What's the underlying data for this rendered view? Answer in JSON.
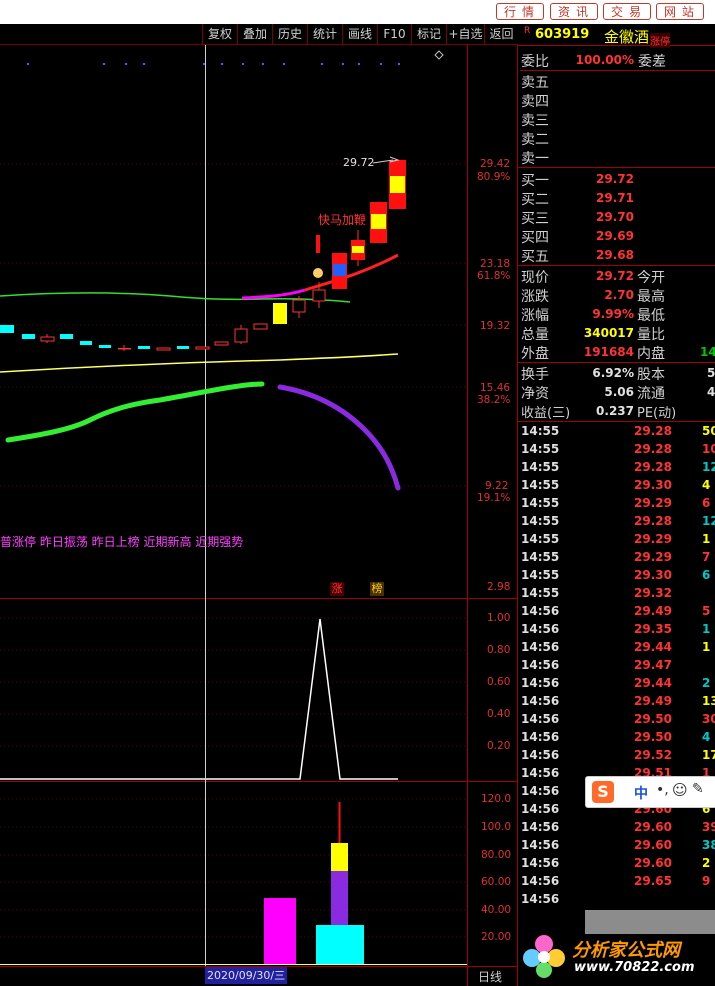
{
  "topnav": [
    "行情",
    "资讯",
    "交易",
    "网站"
  ],
  "toolbar": [
    "复权",
    "叠加",
    "历史",
    "统计",
    "画线",
    "F10",
    "标记",
    "+自选",
    "返回"
  ],
  "stock": {
    "prefix": "R",
    "code": "603919",
    "name": "金徽酒",
    "badge": "涨停"
  },
  "order_book": {
    "weibi_label": "委比",
    "weibi_value": "100.00%",
    "weicha_label": "委差",
    "asks": [
      {
        "label": "卖五"
      },
      {
        "label": "卖四"
      },
      {
        "label": "卖三"
      },
      {
        "label": "卖二"
      },
      {
        "label": "卖一"
      }
    ],
    "bids": [
      {
        "label": "买一",
        "price": "29.72"
      },
      {
        "label": "买二",
        "price": "29.71"
      },
      {
        "label": "买三",
        "price": "29.70"
      },
      {
        "label": "买四",
        "price": "29.69"
      },
      {
        "label": "买五",
        "price": "29.68"
      }
    ]
  },
  "quote": [
    {
      "label": "现价",
      "value": "29.72",
      "label2": "今开"
    },
    {
      "label": "涨跌",
      "value": "2.70",
      "label2": "最高"
    },
    {
      "label": "涨幅",
      "value": "9.99%",
      "label2": "最低"
    },
    {
      "label": "总量",
      "value": "340017",
      "label2": "量比"
    },
    {
      "label": "外盘",
      "value": "191684",
      "label2": "内盘",
      "value2": "14"
    }
  ],
  "stats": [
    {
      "label": "换手",
      "value": "6.92%",
      "label2": "股本",
      "value2": "5"
    },
    {
      "label": "净资",
      "value": "5.06",
      "label2": "流通",
      "value2": "4"
    },
    {
      "label": "收益(三)",
      "value": "0.237",
      "label2": "PE(动)"
    }
  ],
  "ticks": [
    {
      "time": "14:55",
      "price": "29.28",
      "vol": "50"
    },
    {
      "time": "14:55",
      "price": "29.28",
      "vol": "10"
    },
    {
      "time": "14:55",
      "price": "29.28",
      "vol": "12"
    },
    {
      "time": "14:55",
      "price": "29.30",
      "vol": "4"
    },
    {
      "time": "14:55",
      "price": "29.29",
      "vol": "6"
    },
    {
      "time": "14:55",
      "price": "29.28",
      "vol": "12"
    },
    {
      "time": "14:55",
      "price": "29.29",
      "vol": "1"
    },
    {
      "time": "14:55",
      "price": "29.29",
      "vol": "7"
    },
    {
      "time": "14:55",
      "price": "29.30",
      "vol": "6"
    },
    {
      "time": "14:55",
      "price": "29.32",
      "vol": ""
    },
    {
      "time": "14:56",
      "price": "29.49",
      "vol": "5"
    },
    {
      "time": "14:56",
      "price": "29.35",
      "vol": "1"
    },
    {
      "time": "14:56",
      "price": "29.44",
      "vol": "1"
    },
    {
      "time": "14:56",
      "price": "29.47",
      "vol": ""
    },
    {
      "time": "14:56",
      "price": "29.44",
      "vol": "2"
    },
    {
      "time": "14:56",
      "price": "29.49",
      "vol": "13"
    },
    {
      "time": "14:56",
      "price": "29.50",
      "vol": "30"
    },
    {
      "time": "14:56",
      "price": "29.50",
      "vol": "4"
    },
    {
      "time": "14:56",
      "price": "29.52",
      "vol": "17"
    },
    {
      "time": "14:56",
      "price": "29.51",
      "vol": "1"
    },
    {
      "time": "14:56",
      "price": "29.60",
      "vol": ""
    },
    {
      "time": "14:56",
      "price": "29.60",
      "vol": "6"
    },
    {
      "time": "14:56",
      "price": "29.60",
      "vol": "39"
    },
    {
      "time": "14:56",
      "price": "29.60",
      "vol": "38"
    },
    {
      "time": "14:56",
      "price": "29.60",
      "vol": "2"
    },
    {
      "time": "14:56",
      "price": "29.65",
      "vol": "9"
    },
    {
      "time": "14:56",
      "price": "",
      "vol": ""
    }
  ],
  "main_axis": [
    {
      "price": "29.42",
      "pct": "80.9%"
    },
    {
      "price": "23.18",
      "pct": "61.8%"
    },
    {
      "price": "19.32",
      "pct": ""
    },
    {
      "price": "15.46",
      "pct": "38.2%"
    },
    {
      "price": "9.22",
      "pct": "19.1%"
    },
    {
      "price": "2.98",
      "pct": ""
    }
  ],
  "chart": {
    "peak_label": "29.72",
    "signal_label": "快马加鞭",
    "tags_text": "普涨停 昨日振荡 昨日上榜 近期新高 近期强势",
    "badge_zhang": "涨",
    "badge_bang": "榜",
    "date_label": "2020/09/30/三",
    "period": "日线"
  },
  "sub1_axis": [
    "1.00",
    "0.80",
    "0.60",
    "0.40",
    "0.20"
  ],
  "sub2_axis": [
    "120.0",
    "100.0",
    "80.00",
    "60.00",
    "40.00",
    "20.00"
  ],
  "watermark": {
    "site": "分析家公式网",
    "url": "www.70822.com"
  },
  "ime": {
    "label": "中"
  },
  "colors": {
    "up": "#ff3333",
    "down": "#00ffff",
    "axis_red": "#e03030",
    "ma_green": "#33dd33",
    "ma_yellow": "#ffff66",
    "magenta": "#ff00ff",
    "purple": "#8a2be2"
  }
}
